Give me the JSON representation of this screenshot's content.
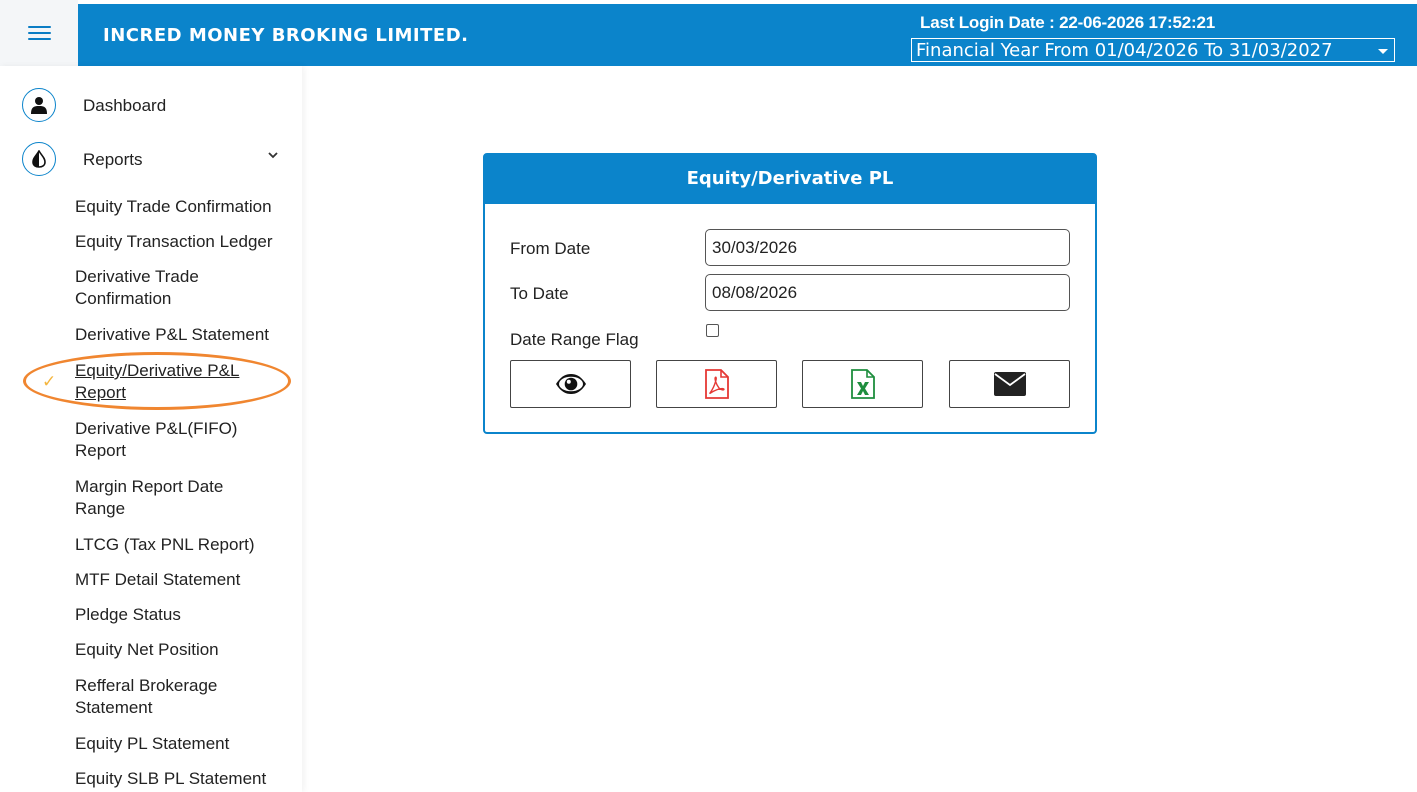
{
  "header": {
    "company": "INCRED MONEY BROKING LIMITED.",
    "last_login": "Last Login Date : 22-06-2026 17:52:21",
    "financial_year": "Financial Year From 01/04/2026 To 31/03/2027"
  },
  "sidebar": {
    "dashboard": "Dashboard",
    "reports": "Reports",
    "report_items": [
      "Equity Trade Confirmation",
      "Equity Transaction Ledger",
      "Derivative Trade Confirmation",
      "Derivative P&L Statement",
      "Equity/Derivative P&L Report",
      "Derivative P&L(FIFO) Report",
      "Margin Report Date Range",
      "LTCG (Tax PNL Report)",
      "MTF Detail Statement",
      "Pledge Status",
      "Equity Net Position",
      "Refferal Brokerage Statement",
      "Equity PL Statement",
      "Equity SLB PL Statement"
    ],
    "active_index": 4,
    "active_mark": "✓"
  },
  "form": {
    "title": "Equity/Derivative PL",
    "from_date_label": "From Date",
    "from_date_value": "30/03/2026",
    "to_date_label": "To Date",
    "to_date_value": "08/08/2026",
    "date_range_flag_label": "Date Range Flag",
    "date_range_flag_checked": false,
    "buttons": [
      "eye-icon",
      "pdf-icon",
      "excel-icon",
      "envelope-icon"
    ]
  },
  "colors": {
    "primary": "#0b84cb",
    "highlight": "#f08630",
    "check": "#f4b63f",
    "pdf": "#e53935",
    "excel": "#1e8e3e"
  }
}
